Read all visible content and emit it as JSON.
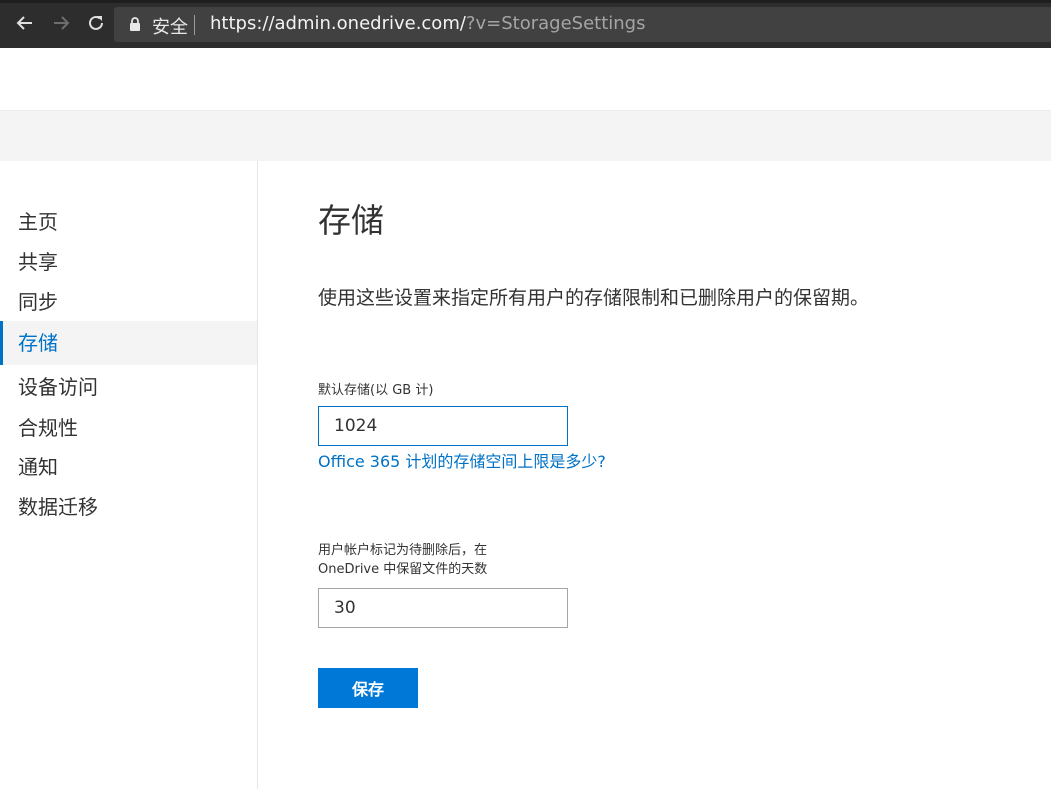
{
  "browser": {
    "secure_label": "安全",
    "url_base": "https://admin.onedrive.com/",
    "url_query": "?v=StorageSettings"
  },
  "sidebar": {
    "items": [
      {
        "label": "主页"
      },
      {
        "label": "共享"
      },
      {
        "label": "同步"
      },
      {
        "label": "存储",
        "active": true
      },
      {
        "label": "设备访问"
      },
      {
        "label": "合规性"
      },
      {
        "label": "通知"
      },
      {
        "label": "数据迁移"
      }
    ]
  },
  "main": {
    "title": "存储",
    "description": "使用这些设置来指定所有用户的存储限制和已删除用户的保留期。",
    "default_storage": {
      "label": "默认存储(以 GB 计)",
      "value": "1024"
    },
    "help_link": "Office 365 计划的存储空间上限是多少?",
    "retention": {
      "label_line1": "用户帐户标记为待删除后，在",
      "label_line2": "OneDrive 中保留文件的天数",
      "value": "30"
    },
    "save_label": "保存"
  },
  "colors": {
    "accent": "#0078d7",
    "link": "#0072c6",
    "browser_bar": "#2d2d2d"
  }
}
